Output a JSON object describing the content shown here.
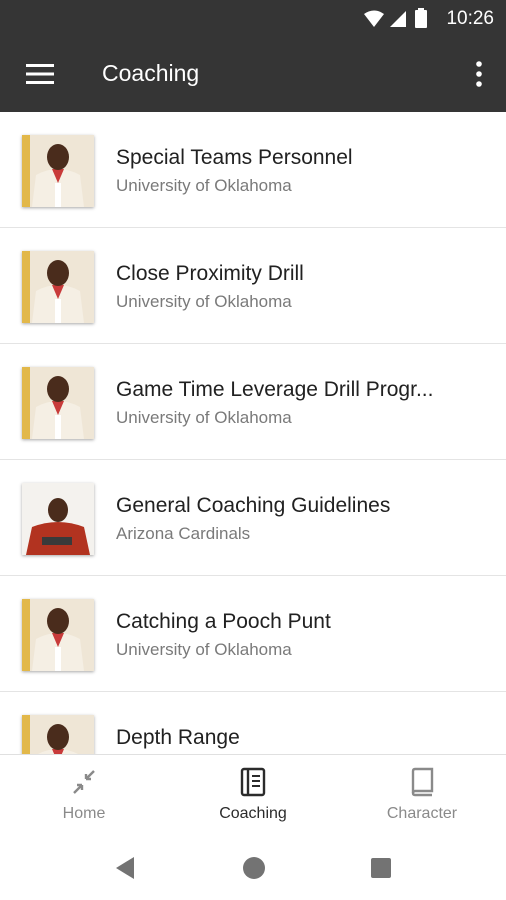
{
  "status_bar": {
    "time": "10:26",
    "icons": [
      "wifi-icon",
      "signal-icon",
      "battery-icon"
    ]
  },
  "app_bar": {
    "title": "Coaching",
    "menu_icon": "hamburger-menu-icon",
    "overflow_icon": "more-vert-icon",
    "background": "#353535"
  },
  "list": {
    "items": [
      {
        "title": "Special Teams Personnel",
        "subtitle": "University of Oklahoma",
        "thumbnail": "coach-photo-white-shirt"
      },
      {
        "title": "Close Proximity Drill",
        "subtitle": "University of Oklahoma",
        "thumbnail": "coach-photo-white-shirt"
      },
      {
        "title": "Game Time Leverage Drill Progr...",
        "subtitle": "University of Oklahoma",
        "thumbnail": "coach-photo-white-shirt"
      },
      {
        "title": "General Coaching Guidelines",
        "subtitle": "Arizona Cardinals",
        "thumbnail": "coach-photo-red-shirt"
      },
      {
        "title": "Catching a Pooch Punt",
        "subtitle": "University of Oklahoma",
        "thumbnail": "coach-photo-white-shirt"
      },
      {
        "title": "Depth Range",
        "subtitle": "",
        "thumbnail": "coach-photo-white-shirt"
      }
    ]
  },
  "bottom_nav": {
    "items": [
      {
        "label": "Home",
        "icon": "collapse-arrows-icon",
        "active": false
      },
      {
        "label": "Coaching",
        "icon": "notebook-icon",
        "active": true
      },
      {
        "label": "Character",
        "icon": "book-icon",
        "active": false
      }
    ]
  },
  "system_nav": {
    "icons": [
      "back-icon",
      "home-circle-icon",
      "recents-square-icon"
    ]
  }
}
